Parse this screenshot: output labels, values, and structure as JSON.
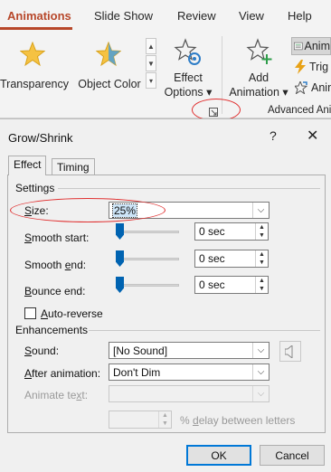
{
  "ribbon": {
    "tabs": [
      {
        "label": "Animations",
        "active": true
      },
      {
        "label": "Slide Show",
        "active": false
      },
      {
        "label": "Review",
        "active": false
      },
      {
        "label": "View",
        "active": false
      },
      {
        "label": "Help",
        "active": false
      }
    ],
    "effects": {
      "transparency_label": "Transparency",
      "object_color_label": "Object Color"
    },
    "effect_options": {
      "line1": "Effect",
      "line2": "Options"
    },
    "add_animation": {
      "line1": "Add",
      "line2": "Animation"
    },
    "advanced": {
      "animation_pane": "Anim",
      "trigger": "Trig",
      "animation_painter": "Anim"
    },
    "advanced_group_label": "Advanced Ani",
    "accent_color": "#b7472a"
  },
  "dialog": {
    "title": "Grow/Shrink",
    "help_glyph": "?",
    "close_glyph": "✕",
    "tabs": [
      {
        "label": "Effect",
        "active": true
      },
      {
        "label": "Timing",
        "active": false
      }
    ],
    "settings": {
      "section_label": "Settings",
      "size_label": "Size:",
      "size_value": "25%",
      "smooth_start_label": "Smooth start:",
      "smooth_start_value": "0 sec",
      "smooth_end_label": "Smooth end:",
      "smooth_end_value": "0 sec",
      "bounce_end_label": "Bounce end:",
      "bounce_end_value": "0 sec",
      "auto_reverse_label": "Auto-reverse",
      "auto_reverse_checked": false
    },
    "enhancements": {
      "section_label": "Enhancements",
      "sound_label": "Sound:",
      "sound_value": "[No Sound]",
      "after_animation_label": "After animation:",
      "after_animation_value": "Don't Dim",
      "animate_text_label": "Animate text:",
      "animate_text_value": "",
      "delay_value": "",
      "delay_label": "% delay between letters"
    },
    "buttons": {
      "ok": "OK",
      "cancel": "Cancel"
    }
  }
}
